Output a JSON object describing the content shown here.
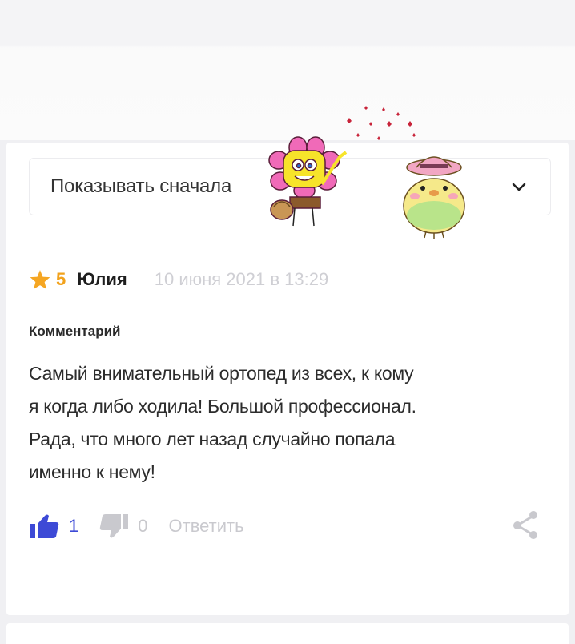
{
  "sort": {
    "label": "Показывать сначала"
  },
  "review": {
    "rating": "5",
    "author": "Юлия",
    "date": "10 июня 2021 в 13:29",
    "comment_label": "Комментарий",
    "comment_lines": [
      "Самый внимательный ортопед из всех, к кому",
      "я когда либо ходила! Большой профессионал.",
      "Рада, что много лет назад случайно попала",
      "именно к нему!"
    ],
    "likes": "1",
    "dislikes": "0",
    "reply_label": "Ответить"
  },
  "icons": {
    "rating": "star-icon",
    "like": "thumbs-up-icon",
    "dislike": "thumbs-down-icon",
    "share": "share-icon",
    "sort": "chevron-down-icon"
  },
  "colors": {
    "star": "#f5a623",
    "like_active": "#3d4ad6",
    "muted": "#c9c9ce",
    "card": "#ffffff",
    "background": "#f0f0f3"
  }
}
